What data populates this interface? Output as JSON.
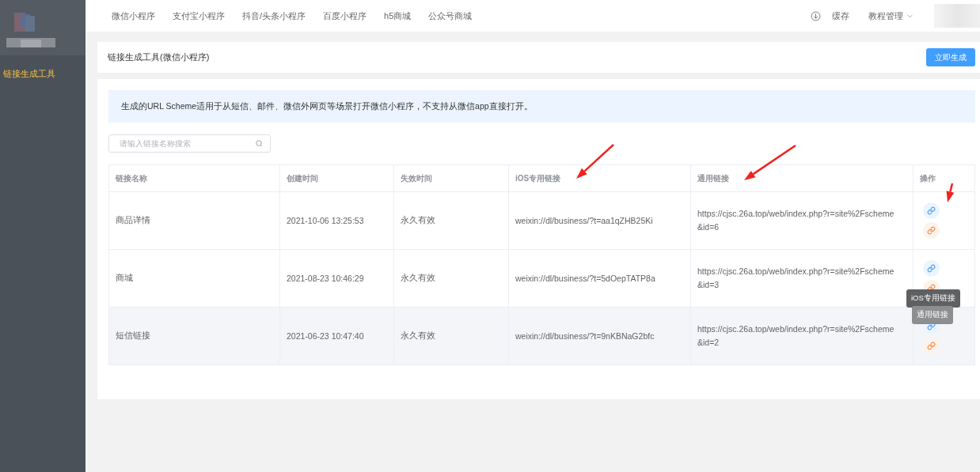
{
  "sidebar": {
    "items": [
      {
        "label": "链接生成工具",
        "selected": true
      }
    ]
  },
  "top_nav": {
    "items": [
      {
        "label": "微信小程序"
      },
      {
        "label": "支付宝小程序"
      },
      {
        "label": "抖音/头条小程序"
      },
      {
        "label": "百度小程序"
      },
      {
        "label": "h5商城"
      },
      {
        "label": "公众号商城"
      }
    ],
    "cache": "缓存",
    "menu": "教程管理"
  },
  "header_card": {
    "title": "链接生成工具(微信小程序)",
    "button": "立即生成"
  },
  "alert": "生成的URL Scheme适用于从短信、邮件、微信外网页等场景打开微信小程序，不支持从微信app直接打开。",
  "search": {
    "placeholder": "请输入链接名称搜索"
  },
  "table": {
    "columns": [
      "链接名称",
      "创建时间",
      "失效时间",
      "iOS专用链接",
      "通用链接",
      "操作"
    ],
    "rows": [
      {
        "name": "商品详情",
        "created": "2021-10-06 13:25:53",
        "expires": "永久有效",
        "ios_link": "weixin://dl/business/?t=aa1qZHB25Ki",
        "link_1": "https://cjsc.26a.top/web/index.php?r=site%2Fscheme",
        "link_2": "&id=6",
        "hovered": false
      },
      {
        "name": "商城",
        "created": "2021-08-23 10:46:29",
        "expires": "永久有效",
        "ios_link": "weixin://dl/business/?t=5dOepTATP8a",
        "link_1": "https://cjsc.26a.top/web/index.php?r=site%2Fscheme",
        "link_2": "&id=3",
        "hovered": false
      },
      {
        "name": "短信链接",
        "created": "2021-06-23 10:47:40",
        "expires": "永久有效",
        "ios_link": "weixin://dl/business/?t=9nKBNaG2bfc",
        "link_1": "https://cjsc.26a.top/web/index.php?r=site%2Fscheme",
        "link_2": "&id=2",
        "hovered": true
      }
    ]
  },
  "tooltips": [
    {
      "text": "iOS专用链接",
      "kind": "dark"
    },
    {
      "text": "通用链接",
      "kind": "light"
    }
  ]
}
